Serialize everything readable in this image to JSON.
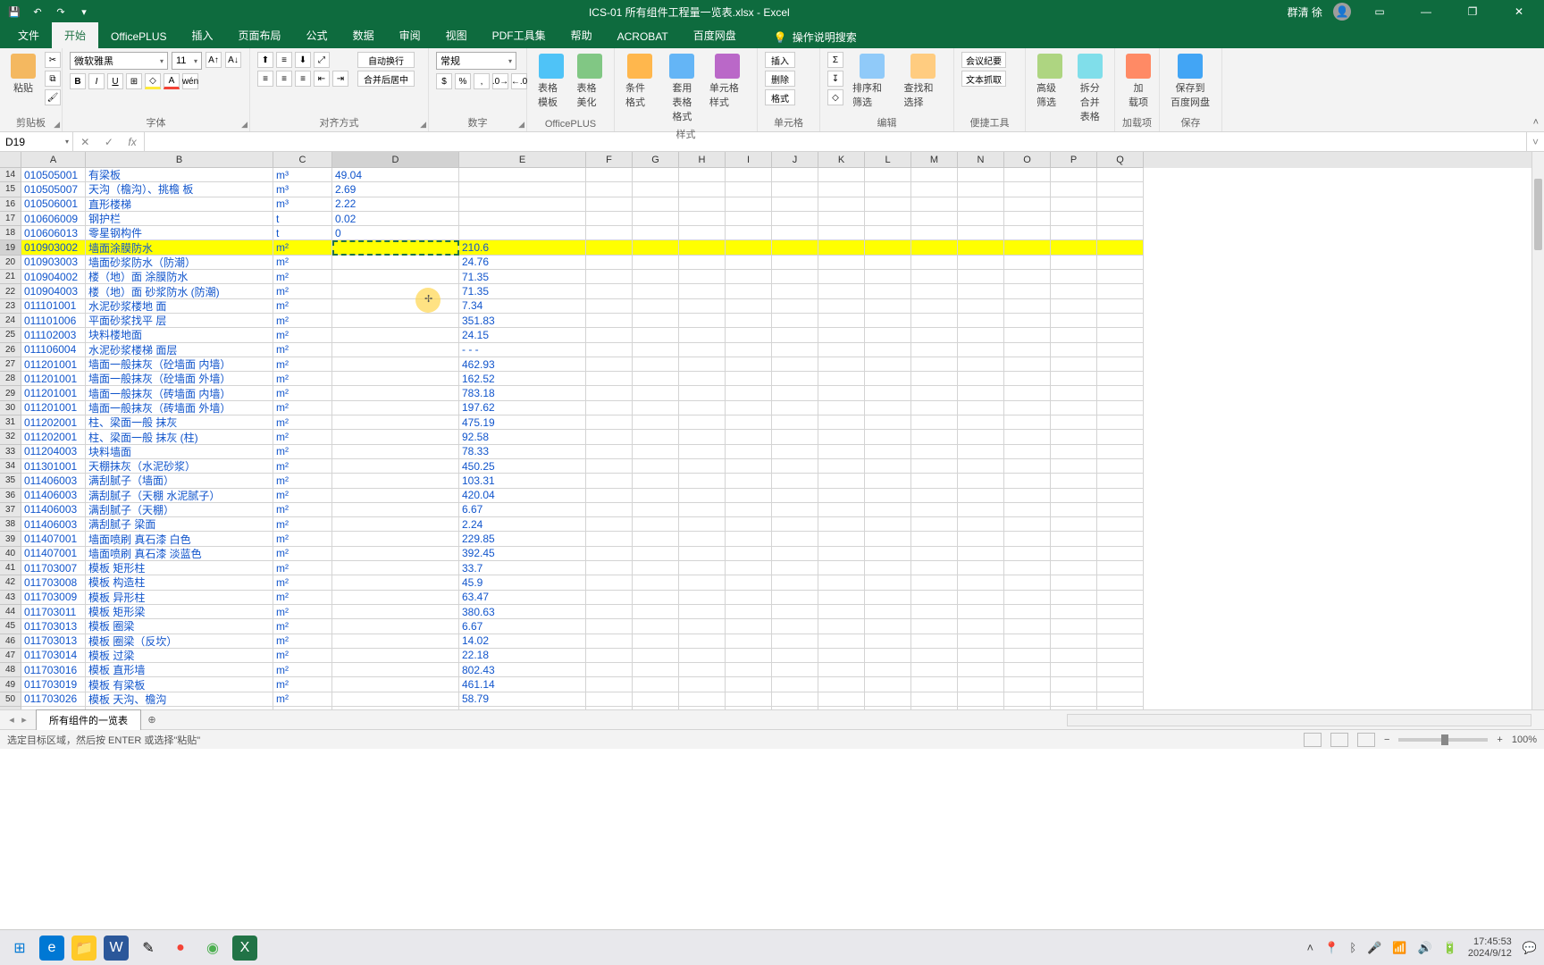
{
  "title": "ICS-01 所有组件工程量一览表.xlsx - Excel",
  "user_name": "群清 徐",
  "tabs": {
    "file": "文件",
    "home": "开始",
    "officeplus": "OfficePLUS",
    "insert": "插入",
    "layout": "页面布局",
    "formula": "公式",
    "data": "数据",
    "review": "审阅",
    "view": "视图",
    "pdf": "PDF工具集",
    "help": "帮助",
    "acrobat": "ACROBAT",
    "baidu": "百度网盘",
    "tell_me": "操作说明搜索"
  },
  "ribbon": {
    "clipboard": {
      "paste": "粘贴",
      "label": "剪贴板"
    },
    "font": {
      "name": "微软雅黑",
      "size": "11",
      "label": "字体"
    },
    "align": {
      "wrap": "自动换行",
      "merge": "合并后居中",
      "label": "对齐方式"
    },
    "number": {
      "format": "常规",
      "label": "数字"
    },
    "officeplus": {
      "tmpl": "表格模板",
      "beau": "表格美化",
      "label": "OfficePLUS"
    },
    "styles": {
      "cond": "条件格式",
      "table": "套用\n表格格式",
      "cell": "单元格样式",
      "label": "样式"
    },
    "cells": {
      "insert": "插入",
      "delete": "删除",
      "format": "格式",
      "label": "单元格"
    },
    "editing": {
      "sort": "排序和筛选",
      "find": "查找和选择",
      "label": "编辑"
    },
    "tools": {
      "a": "会议纪要",
      "b": "文本抓取",
      "label": "便捷工具"
    },
    "filter2": {
      "a": "高级筛选",
      "b": "拆分合并\n表格",
      "label": ""
    },
    "addons": {
      "a": "加\n载项",
      "label": "加载项"
    },
    "save": {
      "a": "保存到\n百度网盘",
      "label": "保存"
    }
  },
  "namebox": "D19",
  "formula": "",
  "columns": [
    "A",
    "B",
    "C",
    "D",
    "E",
    "F",
    "G",
    "H",
    "I",
    "J",
    "K",
    "L",
    "M",
    "N",
    "O",
    "P",
    "Q"
  ],
  "col_widths": [
    "cA",
    "cB",
    "cC",
    "cD",
    "cE",
    "cR",
    "cR",
    "cR",
    "cR",
    "cR",
    "cR",
    "cR",
    "cR",
    "cR",
    "cR",
    "cR",
    "cR"
  ],
  "active_cell": "D19",
  "highlight_row": 19,
  "first_row": 14,
  "rows": [
    {
      "n": 14,
      "a": "010505001",
      "b": "有梁板",
      "c": "m³",
      "d": "49.04",
      "e": ""
    },
    {
      "n": 15,
      "a": "010505007",
      "b": "天沟（檐沟）、挑檐 板",
      "c": "m³",
      "d": "2.69",
      "e": ""
    },
    {
      "n": 16,
      "a": "010506001",
      "b": "直形楼梯",
      "c": "m³",
      "d": "2.22",
      "e": ""
    },
    {
      "n": 17,
      "a": "010606009",
      "b": "钢护栏",
      "c": "t",
      "d": "0.02",
      "e": ""
    },
    {
      "n": 18,
      "a": "010606013",
      "b": "零星钢构件",
      "c": "t",
      "d": "0",
      "e": ""
    },
    {
      "n": 19,
      "a": "010903002",
      "b": "墙面涂膜防水",
      "c": "m²",
      "d": "",
      "e": "210.6"
    },
    {
      "n": 20,
      "a": "010903003",
      "b": "墙面砂浆防水（防潮）",
      "c": "m²",
      "d": "",
      "e": "24.76"
    },
    {
      "n": 21,
      "a": "010904002",
      "b": "楼（地）面 涂膜防水",
      "c": "m²",
      "d": "",
      "e": "71.35"
    },
    {
      "n": 22,
      "a": "010904003",
      "b": "楼（地）面 砂浆防水 (防潮)",
      "c": "m²",
      "d": "",
      "e": "71.35"
    },
    {
      "n": 23,
      "a": "011101001",
      "b": "水泥砂浆楼地 面",
      "c": "m²",
      "d": "",
      "e": "7.34"
    },
    {
      "n": 24,
      "a": "011101006",
      "b": "平面砂浆找平 层",
      "c": "m²",
      "d": "",
      "e": "351.83"
    },
    {
      "n": 25,
      "a": "011102003",
      "b": "块料楼地面",
      "c": "m²",
      "d": "",
      "e": "24.15"
    },
    {
      "n": 26,
      "a": "011106004",
      "b": "水泥砂浆楼梯 面层",
      "c": "m²",
      "d": "",
      "e": "- - -"
    },
    {
      "n": 27,
      "a": "011201001",
      "b": "墙面一般抹灰（砼墙面 内墙）",
      "c": "m²",
      "d": "",
      "e": "462.93"
    },
    {
      "n": 28,
      "a": "011201001",
      "b": "墙面一般抹灰（砼墙面 外墙）",
      "c": "m²",
      "d": "",
      "e": "162.52"
    },
    {
      "n": 29,
      "a": "011201001",
      "b": "墙面一般抹灰（砖墙面 内墙）",
      "c": "m²",
      "d": "",
      "e": "783.18"
    },
    {
      "n": 30,
      "a": "011201001",
      "b": "墙面一般抹灰（砖墙面 外墙）",
      "c": "m²",
      "d": "",
      "e": "197.62"
    },
    {
      "n": 31,
      "a": "011202001",
      "b": "柱、梁面一般 抹灰",
      "c": "m²",
      "d": "",
      "e": "475.19"
    },
    {
      "n": 32,
      "a": "011202001",
      "b": "柱、梁面一般 抹灰 (柱)",
      "c": "m²",
      "d": "",
      "e": "92.58"
    },
    {
      "n": 33,
      "a": "011204003",
      "b": "块料墙面",
      "c": "m²",
      "d": "",
      "e": "78.33"
    },
    {
      "n": 34,
      "a": "011301001",
      "b": "天棚抹灰（水泥砂浆）",
      "c": "m²",
      "d": "",
      "e": "450.25"
    },
    {
      "n": 35,
      "a": "011406003",
      "b": "满刮腻子（墙面）",
      "c": "m²",
      "d": "",
      "e": "103.31"
    },
    {
      "n": 36,
      "a": "011406003",
      "b": "满刮腻子（天棚 水泥腻子）",
      "c": "m²",
      "d": "",
      "e": "420.04"
    },
    {
      "n": 37,
      "a": "011406003",
      "b": "满刮腻子（天棚）",
      "c": "m²",
      "d": "",
      "e": "6.67"
    },
    {
      "n": 38,
      "a": "011406003",
      "b": "满刮腻子 梁面",
      "c": "m²",
      "d": "",
      "e": "2.24"
    },
    {
      "n": 39,
      "a": "011407001",
      "b": "墙面喷刷 真石漆 白色",
      "c": "m²",
      "d": "",
      "e": "229.85"
    },
    {
      "n": 40,
      "a": "011407001",
      "b": "墙面喷刷 真石漆 淡蓝色",
      "c": "m²",
      "d": "",
      "e": "392.45"
    },
    {
      "n": 41,
      "a": "011703007",
      "b": "模板 矩形柱",
      "c": "m²",
      "d": "",
      "e": "33.7"
    },
    {
      "n": 42,
      "a": "011703008",
      "b": "模板 构造柱",
      "c": "m²",
      "d": "",
      "e": "45.9"
    },
    {
      "n": 43,
      "a": "011703009",
      "b": "模板 异形柱",
      "c": "m²",
      "d": "",
      "e": "63.47"
    },
    {
      "n": 44,
      "a": "011703011",
      "b": "模板 矩形梁",
      "c": "m²",
      "d": "",
      "e": "380.63"
    },
    {
      "n": 45,
      "a": "011703013",
      "b": "模板 圈梁",
      "c": "m²",
      "d": "",
      "e": "6.67"
    },
    {
      "n": 46,
      "a": "011703013",
      "b": "模板 圈梁（反坎）",
      "c": "m²",
      "d": "",
      "e": "14.02"
    },
    {
      "n": 47,
      "a": "011703014",
      "b": "模板 过梁",
      "c": "m²",
      "d": "",
      "e": "22.18"
    },
    {
      "n": 48,
      "a": "011703016",
      "b": "模板 直形墙",
      "c": "m²",
      "d": "",
      "e": "802.43"
    },
    {
      "n": 49,
      "a": "011703019",
      "b": "模板 有梁板",
      "c": "m²",
      "d": "",
      "e": "461.14"
    },
    {
      "n": 50,
      "a": "011703026",
      "b": "模板 天沟、檐沟",
      "c": "m²",
      "d": "",
      "e": "58.79"
    },
    {
      "n": 51,
      "a": "",
      "b": "",
      "c": "",
      "d": "",
      "e": ""
    }
  ],
  "sheet_tab": "所有组件的一览表",
  "status": "选定目标区域，然后按 ENTER 或选择\"粘贴\"",
  "zoom": "100%",
  "clock": {
    "time": "17:45:53",
    "date": "2024/9/12"
  }
}
